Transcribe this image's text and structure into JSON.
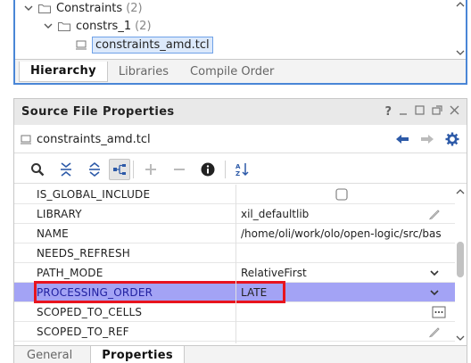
{
  "hierarchy": {
    "constraints_label": "Constraints",
    "constraints_count": "(2)",
    "constrs_label": "constrs_1",
    "constrs_count": "(2)",
    "file_label": "constraints_amd.tcl",
    "tabs": [
      "Hierarchy",
      "Libraries",
      "Compile Order"
    ]
  },
  "properties": {
    "title": "Source File Properties",
    "header_icons": [
      "help-icon",
      "minimize-icon",
      "restore-icon",
      "float-icon",
      "close-icon"
    ],
    "file_name": "constraints_amd.tcl",
    "toolbar_icons": [
      "search-icon",
      "collapse-all-icon",
      "expand-all-icon",
      "hierarchy-icon",
      "add-icon",
      "remove-icon",
      "info-icon",
      "sort-icon"
    ],
    "rows": [
      {
        "name": "IS_GLOBAL_INCLUDE",
        "value": ""
      },
      {
        "name": "LIBRARY",
        "value": "xil_defaultlib"
      },
      {
        "name": "NAME",
        "value": "/home/oli/work/olo/open-logic/src/bas"
      },
      {
        "name": "NEEDS_REFRESH",
        "value": ""
      },
      {
        "name": "PATH_MODE",
        "value": "RelativeFirst"
      },
      {
        "name": "PROCESSING_ORDER",
        "value": "LATE"
      },
      {
        "name": "SCOPED_TO_CELLS",
        "value": ""
      },
      {
        "name": "SCOPED_TO_REF",
        "value": ""
      }
    ],
    "tabs": [
      "General",
      "Properties"
    ],
    "highlight_color": "#a3a3f5",
    "highlight_border_color": "#e8141e",
    "accent_color": "#4a86d6"
  }
}
